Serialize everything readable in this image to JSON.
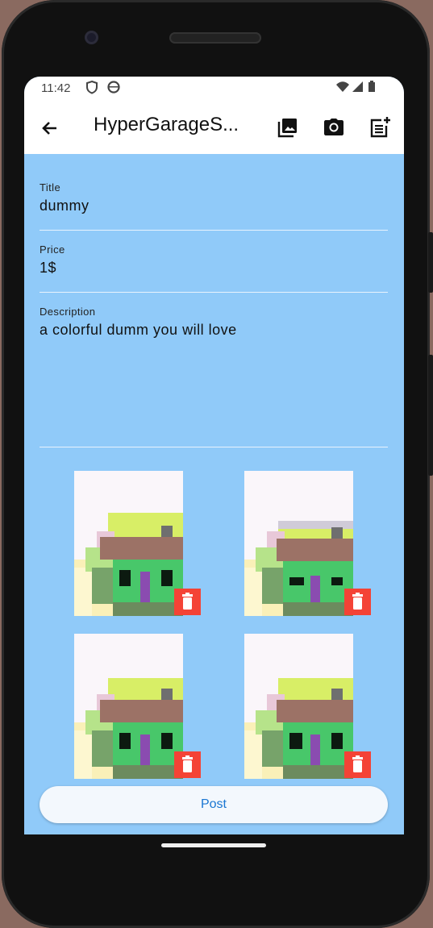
{
  "status_bar": {
    "time": "11:42"
  },
  "app_bar": {
    "title": "HyperGarageS...",
    "icons": [
      "arrow-back-icon",
      "photo-library-icon",
      "camera-icon",
      "post-add-icon"
    ]
  },
  "form": {
    "title_label": "Title",
    "title_value": "dummy",
    "price_label": "Price",
    "price_value": "1$",
    "description_label": "Description",
    "description_value": "a colorful dumm  you will love"
  },
  "images": {
    "count": 4,
    "delete_icon": "delete-icon"
  },
  "post_button": {
    "label": "Post"
  },
  "colors": {
    "background": "#90caf9",
    "delete_button": "#f44336",
    "post_text": "#1976d2"
  }
}
